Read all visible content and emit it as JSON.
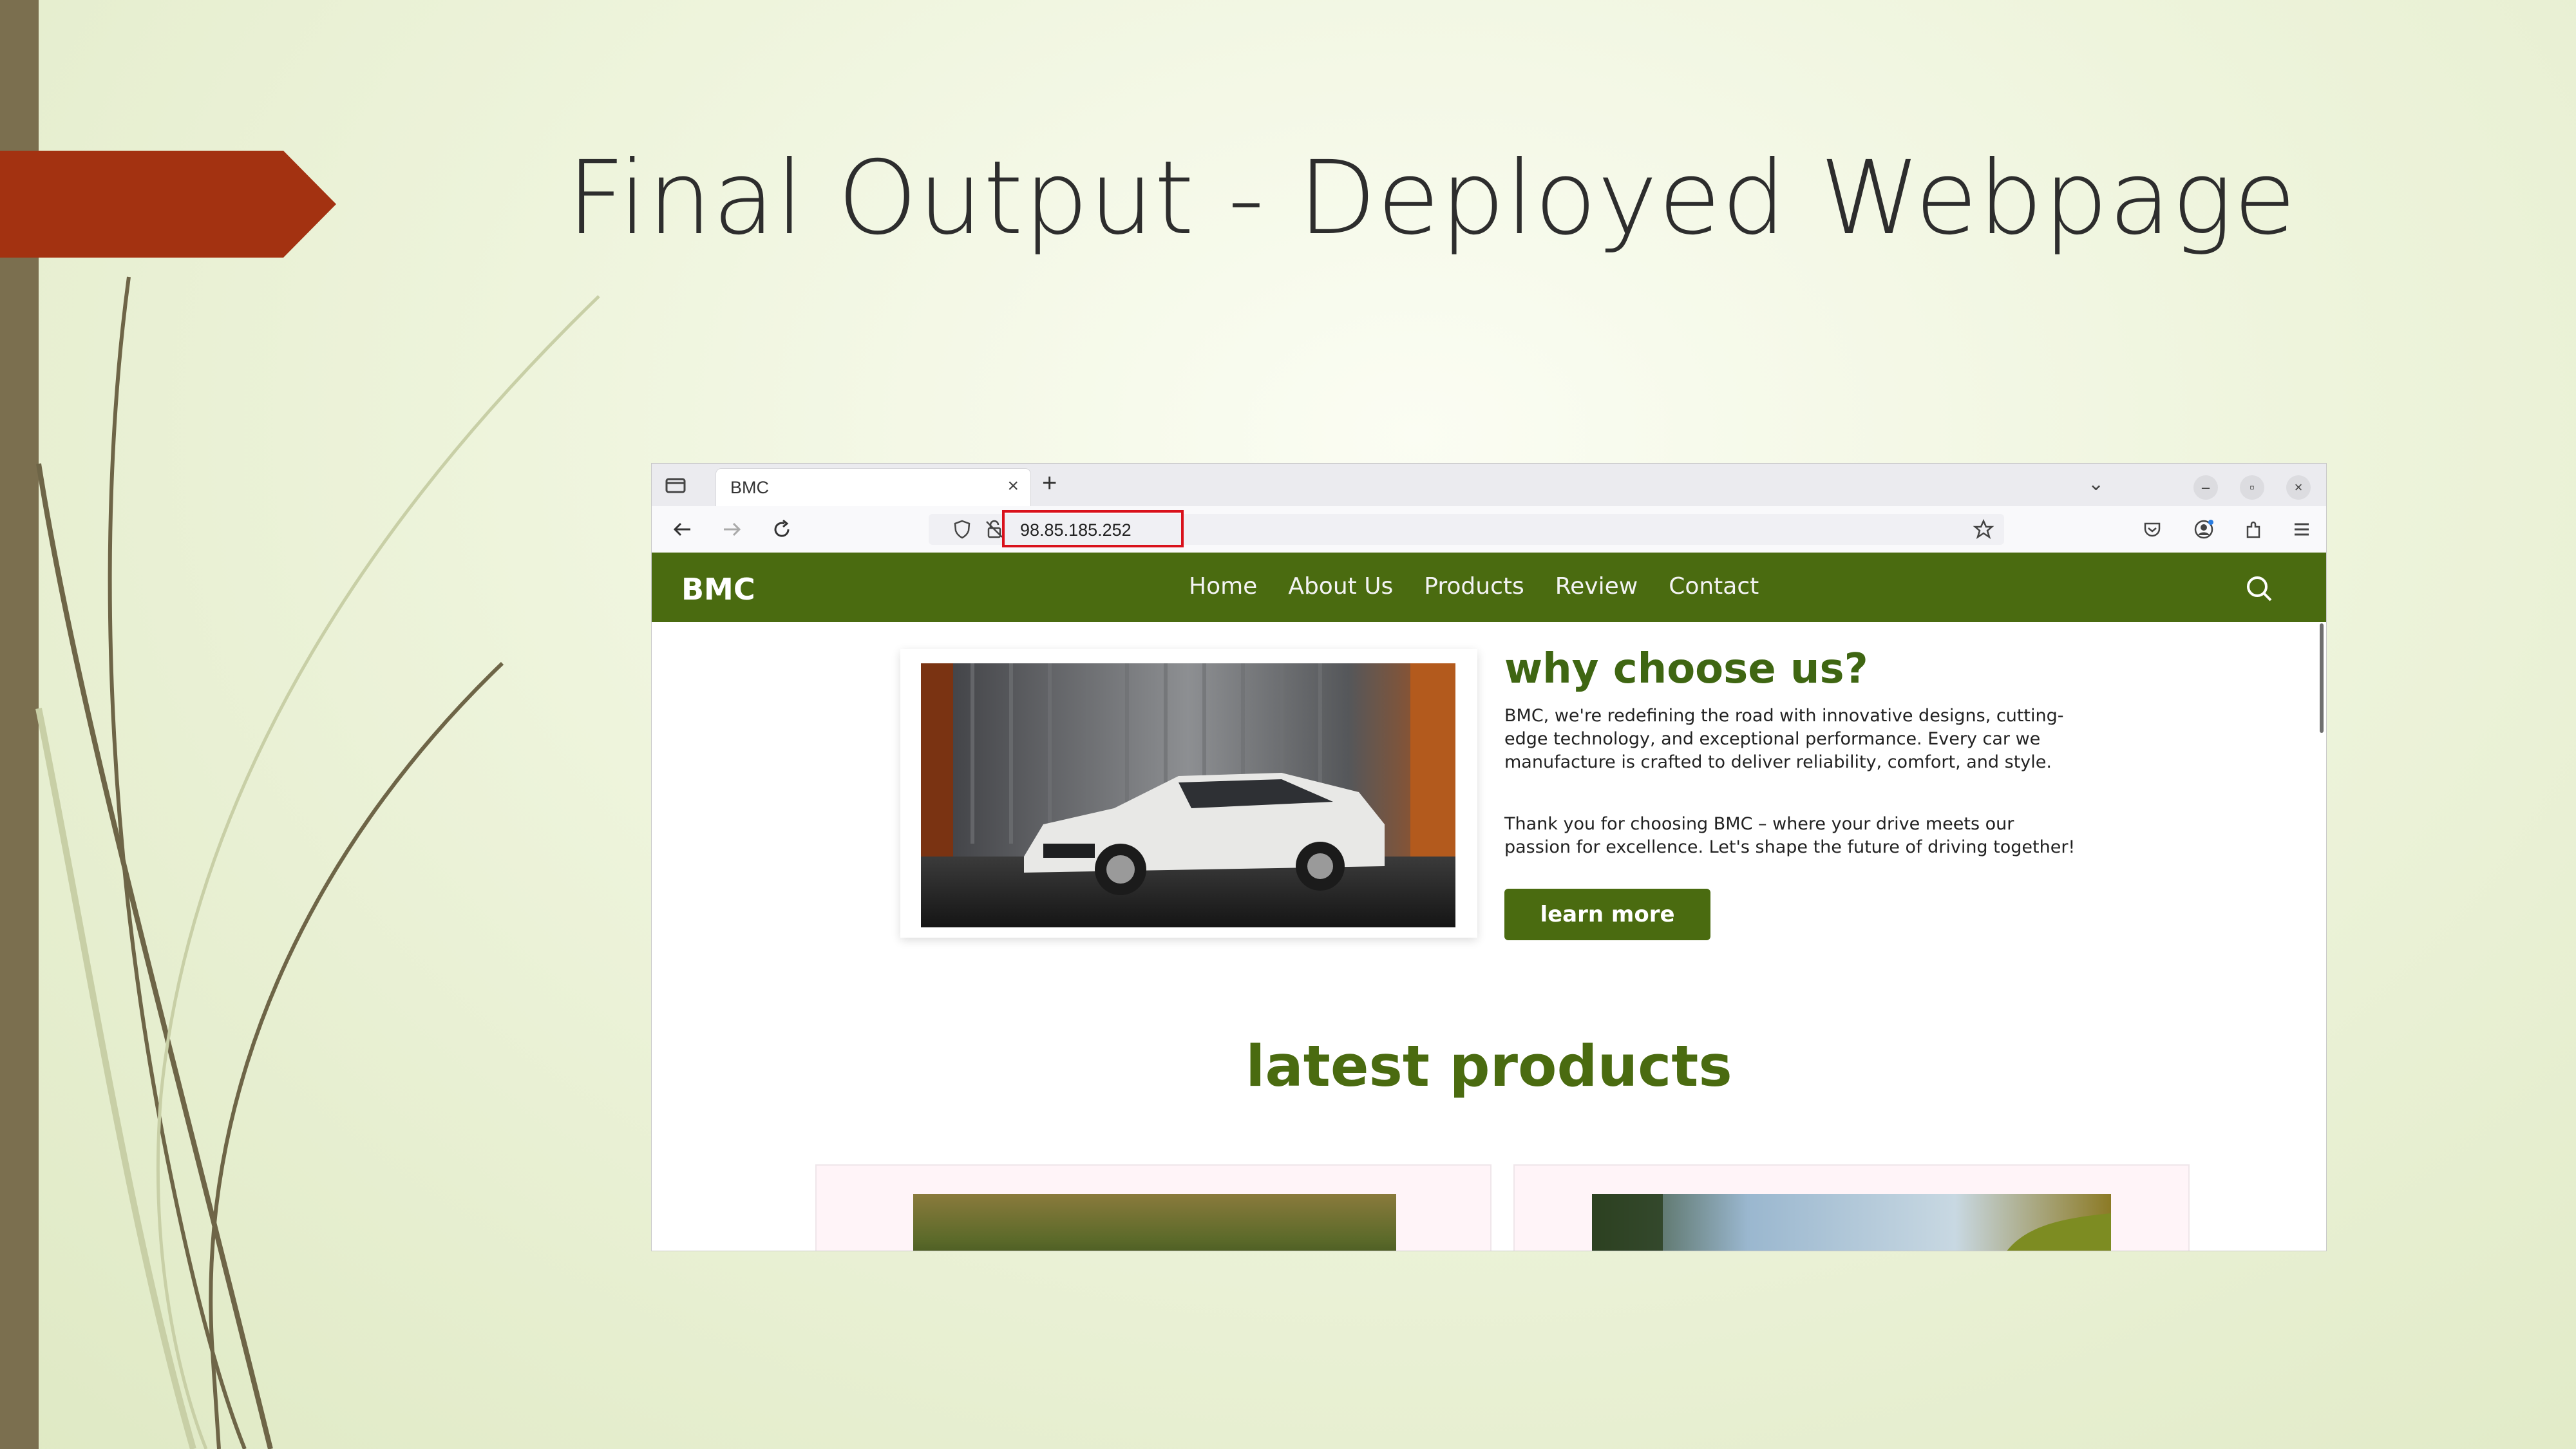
{
  "slide": {
    "title": "Final Output - Deployed Webpage"
  },
  "browser": {
    "tab_title": "BMC",
    "tab_close": "×",
    "new_tab": "+",
    "tabs_menu": "⌄",
    "url": "98.85.185.252",
    "window_buttons": [
      "–",
      "▫",
      "×"
    ]
  },
  "site": {
    "brand": "BMC",
    "nav": [
      "Home",
      "About Us",
      "Products",
      "Review",
      "Contact"
    ],
    "why": {
      "title": "why choose us?",
      "p1": "BMC, we're redefining the road with innovative designs, cutting-edge technology, and exceptional performance. Every car we manufacture is crafted to deliver reliability, comfort, and style.",
      "p2": "Thank you for choosing BMC – where your drive meets our passion for excellence. Let's shape the future of driving together!",
      "button": "learn more"
    },
    "latest": {
      "title": "latest products"
    }
  },
  "colors": {
    "accent_green": "#4a6b10",
    "slide_arrow": "#a33211",
    "url_highlight": "#d9111b"
  }
}
